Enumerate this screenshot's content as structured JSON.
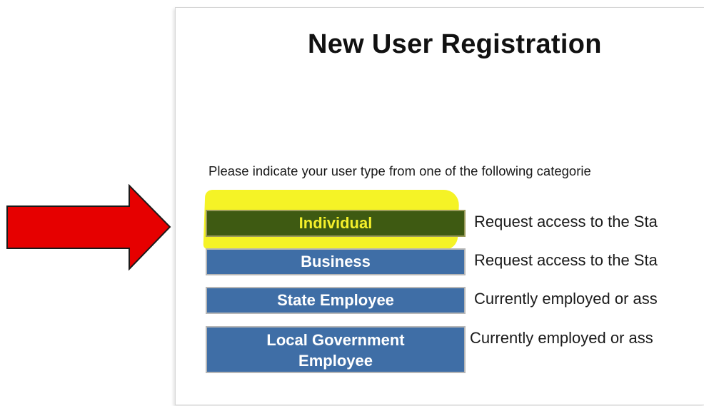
{
  "page": {
    "title": "New User Registration",
    "prompt": "Please indicate your user type from one of the following categorie"
  },
  "categories": [
    {
      "label": "Individual",
      "description": "Request access to the Sta",
      "selected": true
    },
    {
      "label": "Business",
      "description": "Request access to the Sta",
      "selected": false
    },
    {
      "label": "State Employee",
      "description": "Currently employed or ass",
      "selected": false
    },
    {
      "label_line1": "Local Government",
      "label_line2": "Employee",
      "description": "Currently employed or ass",
      "selected": false
    }
  ],
  "colors": {
    "button_blue": "#3f6ea6",
    "selected_button": "#3e5a12",
    "selected_text": "#f4ef2a",
    "highlighter": "#f4f21a",
    "arrow_red": "#e60000"
  },
  "annotations": {
    "arrow_icon": "right-arrow-icon"
  }
}
